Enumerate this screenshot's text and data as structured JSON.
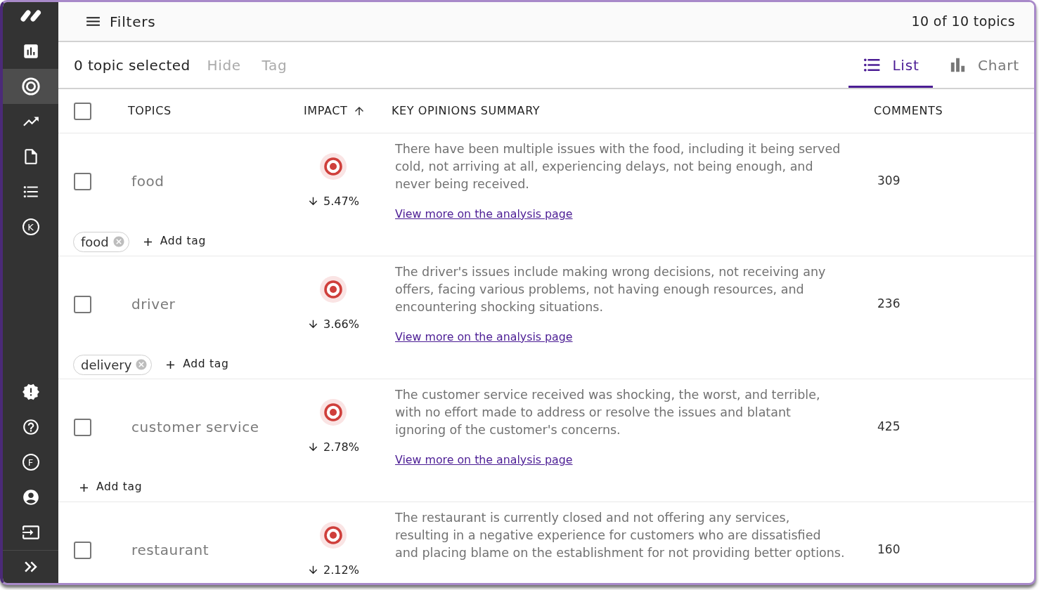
{
  "sidebar": {
    "top_items": [
      {
        "selected": false
      },
      {
        "selected": true
      },
      {
        "selected": false
      },
      {
        "selected": false
      },
      {
        "selected": false
      },
      {
        "selected": false,
        "letter": "K"
      }
    ],
    "bottom_items": [
      {
        "selected": false
      },
      {
        "selected": false
      },
      {
        "selected": false,
        "letter": "F"
      },
      {
        "selected": false
      },
      {
        "selected": false
      }
    ]
  },
  "header": {
    "filters_label": "Filters",
    "count": "10 of 10 topics"
  },
  "toolbar": {
    "selection": "0 topic selected",
    "actions": [
      {
        "label": "Hide",
        "disabled": true
      },
      {
        "label": "Tag",
        "disabled": true
      }
    ],
    "views": [
      {
        "label": "List",
        "selected": true
      },
      {
        "label": "Chart",
        "selected": false
      }
    ]
  },
  "table": {
    "select_all": {
      "checked": false
    },
    "columns": [
      {
        "label": "TOPICS",
        "sorted": false
      },
      {
        "label": "IMPACT",
        "sorted": true
      },
      {
        "label": "KEY OPINIONS SUMMARY",
        "sorted": false
      },
      {
        "label": "COMMENTS",
        "sorted": false
      }
    ],
    "rows": [
      {
        "checked": false,
        "topic": "food",
        "impact": "5.47%",
        "falling": true,
        "summary": "There have been multiple issues with the food, including it being served cold, not arriving at all, experiencing delays, not being enough, and never being received.",
        "link": "View more on the analysis page",
        "comments": "309",
        "tag_line": [
          {
            "kind": "tag",
            "label": "food"
          },
          {
            "kind": "add_button",
            "label": "Add tag"
          }
        ]
      },
      {
        "checked": false,
        "topic": "driver",
        "impact": "3.66%",
        "falling": true,
        "summary": "The driver's issues include making wrong decisions, not receiving any offers, facing various problems, not having enough resources, and encountering shocking situations.",
        "link": "View more on the analysis page",
        "comments": "236",
        "tag_line": [
          {
            "kind": "tag",
            "label": "delivery"
          },
          {
            "kind": "add_button",
            "label": "Add tag"
          }
        ]
      },
      {
        "checked": false,
        "topic": "customer service",
        "impact": "2.78%",
        "falling": true,
        "summary": "The customer service received was shocking, the worst, and terrible, with no effort made to address or resolve the issues and blatant ignoring of the customer's concerns.",
        "link": "View more on the analysis page",
        "comments": "425",
        "tag_line": [
          {
            "kind": "add_button",
            "label": "Add tag"
          }
        ]
      },
      {
        "checked": false,
        "topic": "restaurant",
        "impact": "2.12%",
        "falling": true,
        "summary": "The restaurant is currently closed and not offering any services, resulting in a negative experience for customers who are dissatisfied and placing blame on the establishment for not providing better options.",
        "comments": "160"
      }
    ]
  }
}
